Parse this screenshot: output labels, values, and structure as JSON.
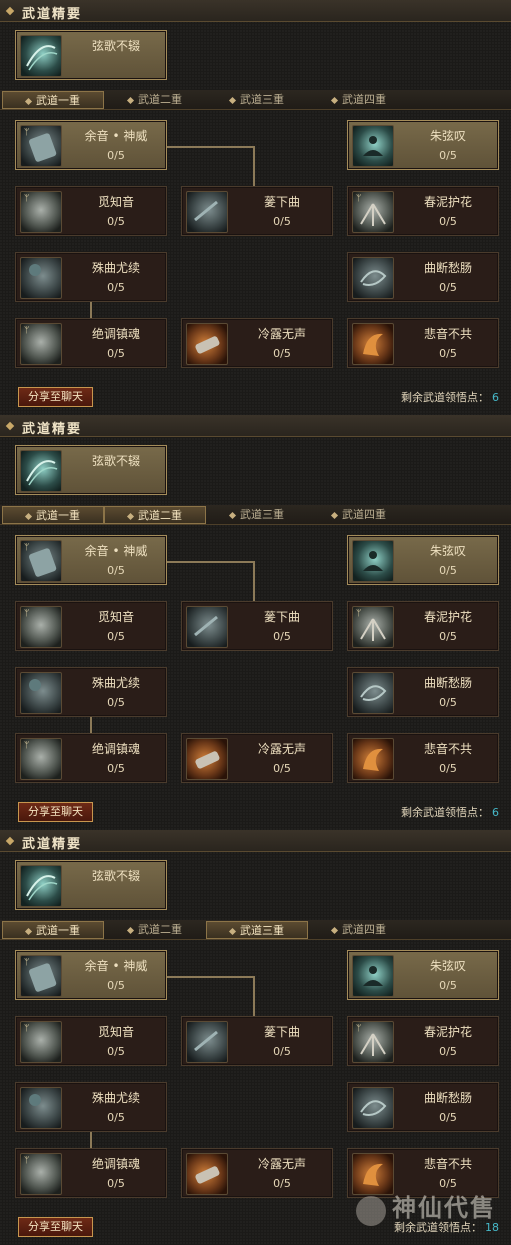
{
  "panels": [
    {
      "essence_title": "武道精要",
      "essence_skill": {
        "name": "弦歌不辍",
        "icon": "teal-strings-icon"
      },
      "tabs": [
        {
          "label": "武道一重",
          "active": true
        },
        {
          "label": "武道二重",
          "active": false
        },
        {
          "label": "武道三重",
          "active": false
        },
        {
          "label": "武道四重",
          "active": false
        }
      ],
      "share_label": "分享至聊天",
      "remaining_label": "剩余武道领悟点：",
      "remaining_value": "6"
    },
    {
      "essence_title": "武道精要",
      "essence_skill": {
        "name": "弦歌不辍",
        "icon": "teal-strings-icon"
      },
      "tabs": [
        {
          "label": "武道一重",
          "active": true
        },
        {
          "label": "武道二重",
          "active": true
        },
        {
          "label": "武道三重",
          "active": false
        },
        {
          "label": "武道四重",
          "active": false
        }
      ],
      "share_label": "分享至聊天",
      "remaining_label": "剩余武道领悟点：",
      "remaining_value": "6"
    },
    {
      "essence_title": "武道精要",
      "essence_skill": {
        "name": "弦歌不辍",
        "icon": "teal-strings-icon"
      },
      "tabs": [
        {
          "label": "武道一重",
          "active": true
        },
        {
          "label": "武道二重",
          "active": false
        },
        {
          "label": "武道三重",
          "active": true
        },
        {
          "label": "武道四重",
          "active": false
        }
      ],
      "share_label": "分享至聊天",
      "remaining_label": "剩余武道领悟点：",
      "remaining_value": "18"
    }
  ],
  "skills": [
    {
      "name": "余音 • 神威",
      "points": "0/5",
      "icon": "zither-icon",
      "highlight": true
    },
    {
      "name": "朱弦叹",
      "points": "0/5",
      "icon": "meditate-icon",
      "highlight": true
    },
    {
      "name": "觅知音",
      "points": "0/5",
      "icon": "mask-icon",
      "highlight": false
    },
    {
      "name": "蓌下曲",
      "points": "0/5",
      "icon": "strike-icon",
      "highlight": false
    },
    {
      "name": "春泥护花",
      "points": "0/5",
      "icon": "wings-icon",
      "highlight": false
    },
    {
      "name": "殊曲尤续",
      "points": "0/5",
      "icon": "orb-icon",
      "highlight": false
    },
    {
      "name": "曲断愁肠",
      "points": "0/5",
      "icon": "swirl-icon",
      "highlight": false
    },
    {
      "name": "绝调镇魂",
      "points": "0/5",
      "icon": "skull-icon",
      "highlight": false
    },
    {
      "name": "冷露无声",
      "points": "0/5",
      "icon": "scroll-icon",
      "highlight": false
    },
    {
      "name": "悲音不共",
      "points": "0/5",
      "icon": "flame-icon",
      "highlight": false
    }
  ],
  "watermark": {
    "text": "神仙代售"
  }
}
